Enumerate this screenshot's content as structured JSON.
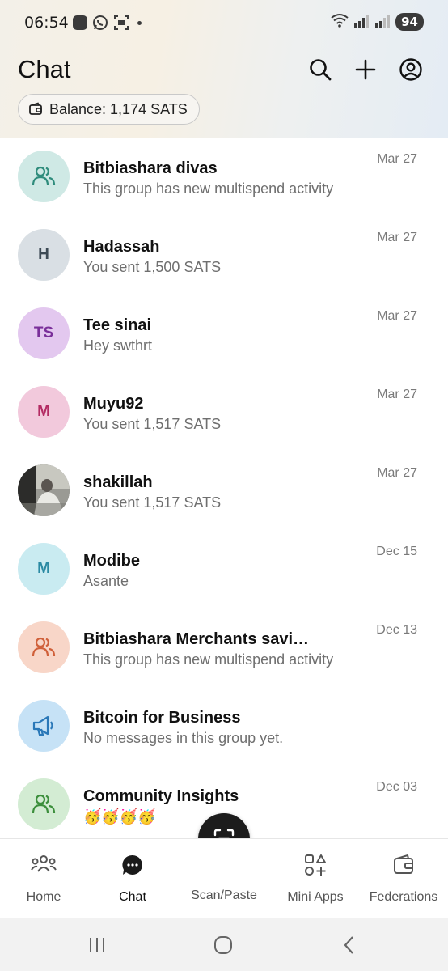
{
  "status_bar": {
    "time": "06:54",
    "battery": "94"
  },
  "header": {
    "title": "Chat",
    "balance": "Balance: 1,174 SATS"
  },
  "chats": [
    {
      "name": "Bitbiashara divas",
      "preview": "This group has new multispend activity",
      "date": "Mar 27",
      "avatar_type": "group",
      "avatar_bg": "#cfe9e5",
      "avatar_fg": "#2f8c7c"
    },
    {
      "name": "Hadassah",
      "preview": "You sent 1,500 SATS",
      "date": "Mar 27",
      "avatar_type": "initials",
      "initials": "H",
      "avatar_bg": "#d9dfe4",
      "avatar_fg": "#3d4a55"
    },
    {
      "name": "Tee sinai",
      "preview": "Hey swthrt",
      "date": "Mar 27",
      "avatar_type": "initials",
      "initials": "TS",
      "avatar_bg": "#e3c8ef",
      "avatar_fg": "#7a2f9a"
    },
    {
      "name": "Muyu92",
      "preview": "You sent 1,517 SATS",
      "date": "Mar 27",
      "avatar_type": "initials",
      "initials": "M",
      "avatar_bg": "#f2c9dc",
      "avatar_fg": "#b32a62"
    },
    {
      "name": "shakillah",
      "preview": "You sent 1,517 SATS",
      "date": "Mar 27",
      "avatar_type": "photo",
      "avatar_bg": "#8a8a8a",
      "avatar_fg": "#ffffff"
    },
    {
      "name": "Modibe",
      "preview": "Asante",
      "date": "Dec 15",
      "avatar_type": "initials",
      "initials": "M",
      "avatar_bg": "#c9ebf1",
      "avatar_fg": "#2a8aa3"
    },
    {
      "name": "Bitbiashara Merchants savi…",
      "preview": "This group has new multispend activity",
      "date": "Dec 13",
      "avatar_type": "group",
      "avatar_bg": "#f8d6c8",
      "avatar_fg": "#d0603a"
    },
    {
      "name": "Bitcoin for Business",
      "preview": "No messages in this group yet.",
      "date": "",
      "avatar_type": "megaphone",
      "avatar_bg": "#c6e2f6",
      "avatar_fg": "#2a78b8"
    },
    {
      "name": "Community Insights",
      "preview": "🥳🥳🥳🥳",
      "date": "Dec 03",
      "avatar_type": "group",
      "avatar_bg": "#d3ecd3",
      "avatar_fg": "#3c8f3c"
    }
  ],
  "nav": {
    "home": "Home",
    "chat": "Chat",
    "scan": "Scan/Paste",
    "mini_apps": "Mini Apps",
    "federations": "Federations"
  },
  "icons": {
    "search": "search-icon",
    "add": "plus-icon",
    "profile": "profile-icon",
    "wallet": "wallet-icon"
  }
}
